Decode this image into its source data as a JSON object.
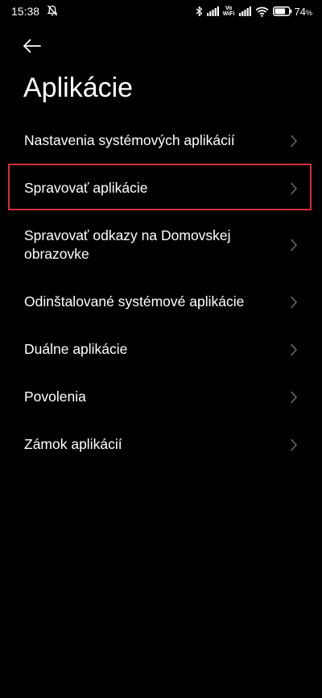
{
  "status_bar": {
    "time": "15:38",
    "volte_top": "Vo",
    "volte_bottom": "WiFi",
    "battery_percent": "74",
    "battery_symbol": "%",
    "battery_level": 0.74
  },
  "header": {
    "title": "Aplikácie"
  },
  "menu": {
    "items": [
      {
        "label": "Nastavenia systémových aplikácií"
      },
      {
        "label": "Spravovať aplikácie"
      },
      {
        "label": "Spravovať odkazy na Domovskej obrazovke"
      },
      {
        "label": "Odinštalované systémové aplikácie"
      },
      {
        "label": "Duálne aplikácie"
      },
      {
        "label": "Povolenia"
      },
      {
        "label": "Zámok aplikácií"
      }
    ],
    "highlighted_item": "Spravovať aplikácie"
  },
  "colors": {
    "background": "#000000",
    "text": "#ffffff",
    "chevron": "#6e6e6e",
    "highlight_border": "#d32f3a"
  }
}
